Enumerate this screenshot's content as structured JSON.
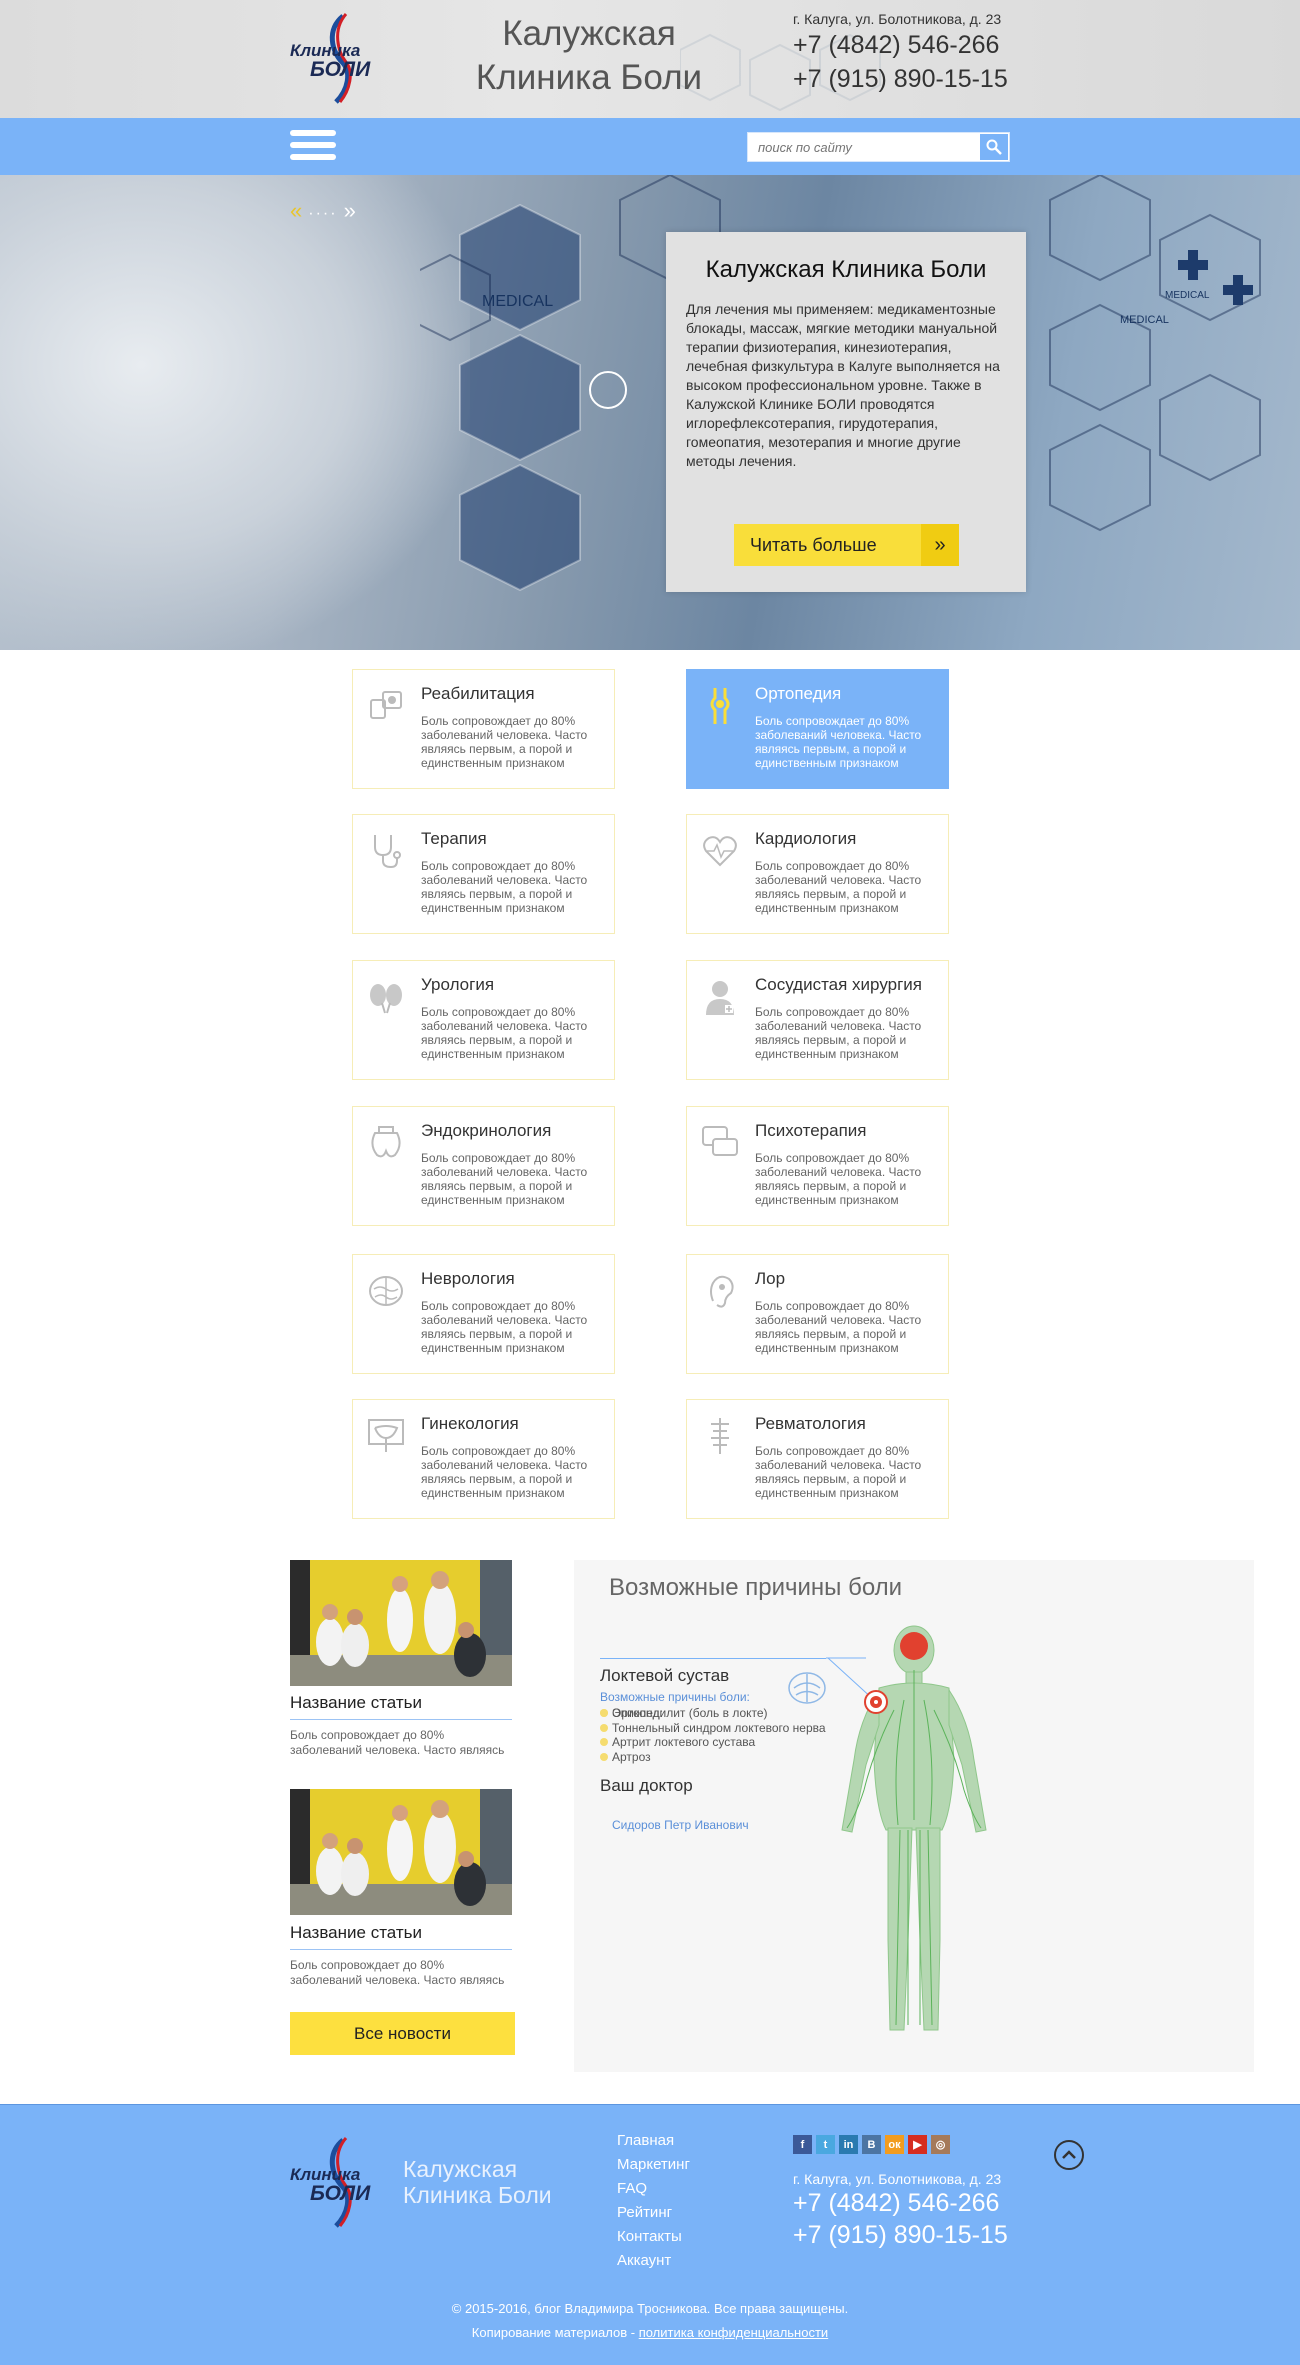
{
  "header": {
    "logo_lettering": "Клиника БОЛИ",
    "title_line1": "Калужская",
    "title_line2": "Клиника Боли",
    "address": "г. Калуга, ул. Болотникова, д. 23",
    "phone1": "+7 (4842) 546-266",
    "phone2": "+7 (915) 890-15-15"
  },
  "navbar": {
    "menu_icon": "hamburger-menu-icon",
    "search_placeholder": "поиск по сайту",
    "search_icon": "magnifier-icon"
  },
  "hero": {
    "prev_icon": "double-chevron-left-icon",
    "dots": "····",
    "next_icon": "double-chevron-right-icon",
    "card_title": "Калужская Клиника Боли",
    "card_text": "Для лечения мы применяем: медикаментозные блокады, массаж, мягкие методики мануальной терапии физиотерапия, кинезиотерапия, лечебная физкультура в Калуге выполняется на высоком профессиональном уровне. Также в Калужской Клинике БОЛИ проводятся иглорефлексотерапия, гирудотерапия, гомеопатия, мезотерапия и многие другие методы лечения.",
    "readmore_label": "Читать больше",
    "readmore_arrow": "»"
  },
  "services": [
    {
      "title": "Реабилитация",
      "text": "Боль сопровождает до 80% заболеваний человека. Часто являясь первым, а порой и единственным признаком",
      "icon": "rehab-device-icon",
      "active": false
    },
    {
      "title": "Ортопедия",
      "text": "Боль сопровождает до 80% заболеваний человека. Часто являясь первым, а порой и единственным признаком",
      "icon": "knee-joint-icon",
      "active": true
    },
    {
      "title": "Терапия",
      "text": "Боль сопровождает до 80% заболеваний человека. Часто являясь первым, а порой и единственным признаком",
      "icon": "stethoscope-icon",
      "active": false
    },
    {
      "title": "Кардиология",
      "text": "Боль сопровождает до 80% заболеваний человека. Часто являясь первым, а порой и единственным признаком",
      "icon": "heart-pulse-icon",
      "active": false
    },
    {
      "title": "Урология",
      "text": "Боль сопровождает до 80% заболеваний человека. Часто являясь первым, а порой и единственным признаком",
      "icon": "kidneys-icon",
      "active": false
    },
    {
      "title": "Сосудистая хирургия",
      "text": "Боль сопровождает до 80% заболеваний человека. Часто являясь первым, а порой и единственным признаком",
      "icon": "surgeon-icon",
      "active": false
    },
    {
      "title": "Эндокринология",
      "text": "Боль сопровождает до 80% заболеваний человека. Часто являясь первым, а порой и единственным признаком",
      "icon": "thyroid-icon",
      "active": false
    },
    {
      "title": "Психотерапия",
      "text": "Боль сопровождает до 80% заболеваний человека. Часто являясь первым, а порой и единственным признаком",
      "icon": "chat-bubbles-icon",
      "active": false
    },
    {
      "title": "Неврология",
      "text": "Боль сопровождает до 80% заболеваний человека. Часто являясь первым, а порой и единственным признаком",
      "icon": "brain-icon",
      "active": false
    },
    {
      "title": "Лор",
      "text": "Боль сопровождает до 80% заболеваний человека. Часто являясь первым, а порой и единственным признаком",
      "icon": "ear-icon",
      "active": false
    },
    {
      "title": "Гинекология",
      "text": "Боль сопровождает до 80% заболеваний человека. Часто являясь первым, а порой и единственным признаком",
      "icon": "uterus-icon",
      "active": false
    },
    {
      "title": "Ревматология",
      "text": "Боль сопровождает до 80% заболеваний человека. Часто являясь первым, а порой и единственным признаком",
      "icon": "spine-icon",
      "active": false
    }
  ],
  "news": [
    {
      "title": "Название статьи",
      "text": "Боль сопровождает до 80% заболеваний человека. Часто являясь"
    },
    {
      "title": "Название статьи",
      "text": "Боль сопровождает до 80% заболеваний человека. Часто являясь"
    }
  ],
  "all_news_label": "Все новости",
  "pain": {
    "title": "Возможные причины боли",
    "joint": "Локтевой сустав",
    "causes_label": "Возможные причины боли:",
    "causes": [
      "Эпикондилит (боль в локте)",
      "Тоннельный синдром локтевого нерва",
      "Артрит локтевого сустава",
      "Артроз"
    ],
    "doctor_title": "Ваш доктор",
    "doctor_role": "Ортопед:",
    "doctor_name": "Сидоров Петр Иванович"
  },
  "footer": {
    "title_line1": "Калужская",
    "title_line2": "Клиника Боли",
    "menu": [
      "Главная",
      "Маркетинг",
      "FAQ",
      "Рейтинг",
      "Контакты",
      "Аккаунт"
    ],
    "social": [
      {
        "icon": "facebook-icon",
        "glyph": "f",
        "color": "#3b5998"
      },
      {
        "icon": "twitter-icon",
        "glyph": "t",
        "color": "#4aa8e0"
      },
      {
        "icon": "linkedin-icon",
        "glyph": "in",
        "color": "#2a7ab0"
      },
      {
        "icon": "vk-icon",
        "glyph": "В",
        "color": "#4c75a3"
      },
      {
        "icon": "odnoklassniki-icon",
        "glyph": "ок",
        "color": "#f29c1f"
      },
      {
        "icon": "youtube-icon",
        "glyph": "▶",
        "color": "#d62d20"
      },
      {
        "icon": "instagram-icon",
        "glyph": "◎",
        "color": "#a57a5a"
      }
    ],
    "address": "г. Калуга, ул. Болотникова, д. 23",
    "phone1": "+7 (4842) 546-266",
    "phone2": "+7 (915) 890-15-15",
    "copyright": "© 2015-2016, блог Владимира Тросникова. Все права защищены.",
    "copy_prefix": "Копирование материалов - ",
    "privacy_link": "политика конфиденциальности",
    "totop_icon": "chevron-up-circle-icon"
  }
}
